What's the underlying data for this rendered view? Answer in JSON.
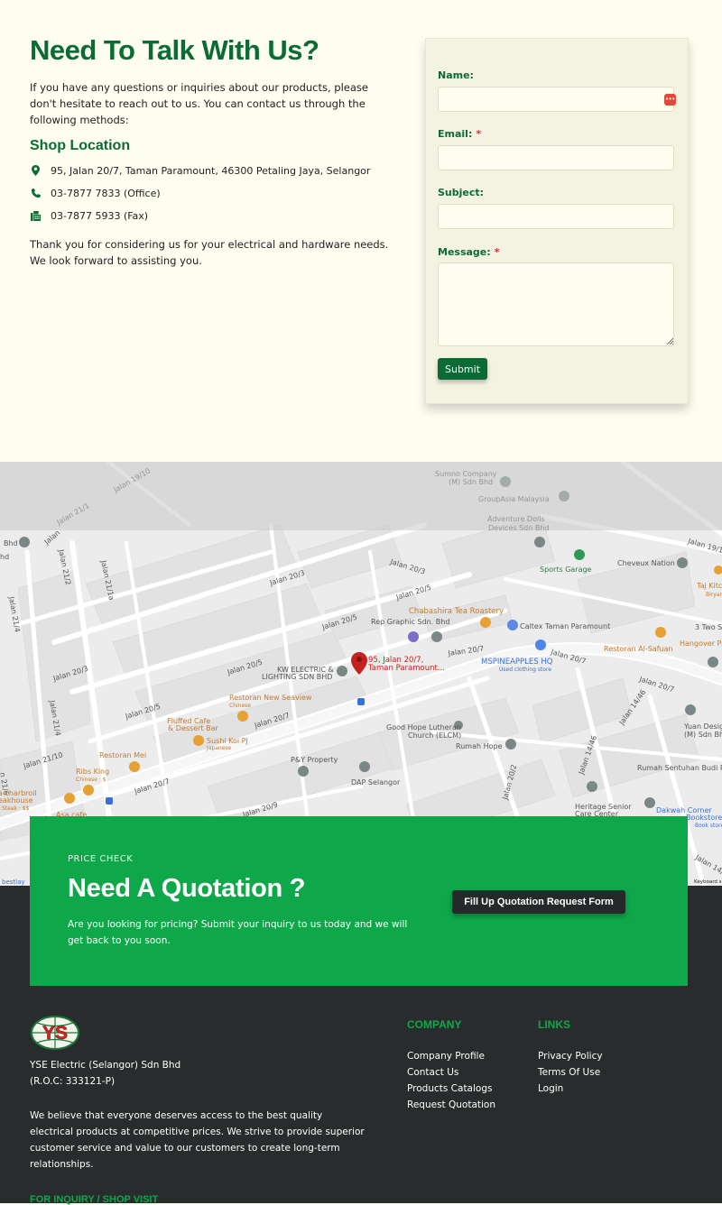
{
  "contact": {
    "title": "Need To Talk With Us?",
    "intro": "If you have any questions or inquiries about our products, please don't hesitate to reach out to us. You can contact us through the following methods:",
    "shop_heading": "Shop Location",
    "address": "95, Jalan 20/7, Taman Paramount, 46300 Petaling Jaya, Selangor",
    "office_phone": "03-7877 7833 (Office)",
    "fax": "03-7877 5933 (Fax)",
    "outro": "Thank you for considering us for your electrical and hardware needs. We look forward to assisting you.",
    "icons": [
      "map-marker-icon",
      "phone-icon",
      "fax-icon"
    ],
    "accent_color": "#0a6b35"
  },
  "form": {
    "name_label": "Name:",
    "email_label": "Email:",
    "subject_label": "Subject:",
    "message_label": "Message:",
    "required_mark": "*",
    "name_value": "",
    "email_value": "",
    "subject_value": "",
    "message_value": "",
    "submit_label": "Submit"
  },
  "map": {
    "roads": [
      "Jalan 20/7",
      "Jalan 20/7",
      "Jalan 20/7",
      "Jalan 20/7",
      "Jalan 20/5",
      "Jalan 20/5",
      "Jalan 20/5",
      "Jalan 20/5",
      "Jalan 20/3",
      "Jalan 20/3",
      "Jalan 20/3",
      "Jalan 21/4",
      "Jalan 21/4",
      "Jalan 21/2",
      "Jalan 21/1a",
      "Jalan 21/10",
      "Jalan 14/46",
      "Jalan 14/46",
      "Jalan 20/2",
      "Jalan 20/9",
      "Jalan 19/1",
      "Jalan 21/1"
    ],
    "places": [
      "Sumno Company (M) Sdn Bhd",
      "GroupAsia Malaysia",
      "Adventure Dolls Devices Sdn Bhd",
      "Sports Garage",
      "Cheveux Nation",
      "Taj Kitc",
      "Biryani",
      "Chabashira Tea Roastery",
      "Rep Graphic Sdn. Bhd",
      "Caltex Taman Paramount",
      "3 Two S",
      "Hangover Pr",
      "Restoran Al-Safuan",
      "KW ELECTRIC & LIGHTING SDN BHD",
      "95, Jalan 20/7, Taman Paramount...",
      "MSPINEAPPLES HQ",
      "Used clothing store",
      "Restoran New Seaview",
      "Chinese",
      "Fluffed Cafe & Dessert Bar",
      "Sushi Koi PJ",
      "Japanese",
      "Good Hope Lutheran Church (ELCM)",
      "Rumah Hope",
      "Yuan Design (M) Sdn Bhd",
      "Restoran Mei",
      "Ribs King",
      "Chinese · $",
      "P&Y Property",
      "DAP Selangor",
      "Rumah Sentuhan Budi P",
      "Heritage Senior Care Center",
      "Dakwah Corner Bookstore",
      "Book store",
      "charbroil",
      "eakhouse",
      "Steak · $$",
      "Asa cafe",
      "Bhd",
      "hd",
      "bestlay",
      "Keyboard s"
    ],
    "pin_color": "#c5221f"
  },
  "quotation": {
    "eyebrow": "PRICE CHECK",
    "title": "Need A Quotation ?",
    "text": "Are you looking for pricing? Submit your inquiry to us today and we will get back to you soon.",
    "button_label": "Fill Up Quotation Request Form",
    "bg_color": "#0ea84a"
  },
  "footer": {
    "logo_text": "YS",
    "company_name": "YSE Electric (Selangor) Sdn Bhd",
    "roc": "(R.O.C: 333121-P)",
    "about": "We believe that everyone deserves access to the best quality electrical products at competitive prices. We strive to provide superior customer service and value to our customers to create long-term relationships.",
    "inquiry_heading": "FOR INQUIRY / SHOP VISIT",
    "company_heading": "COMPANY",
    "company_links": [
      "Company Profile",
      "Contact Us",
      "Products Catalogs",
      "Request Quotation"
    ],
    "links_heading": "LINKS",
    "links": [
      "Privacy Policy",
      "Terms Of Use",
      "Login"
    ],
    "bg_color": "#282c2c"
  }
}
